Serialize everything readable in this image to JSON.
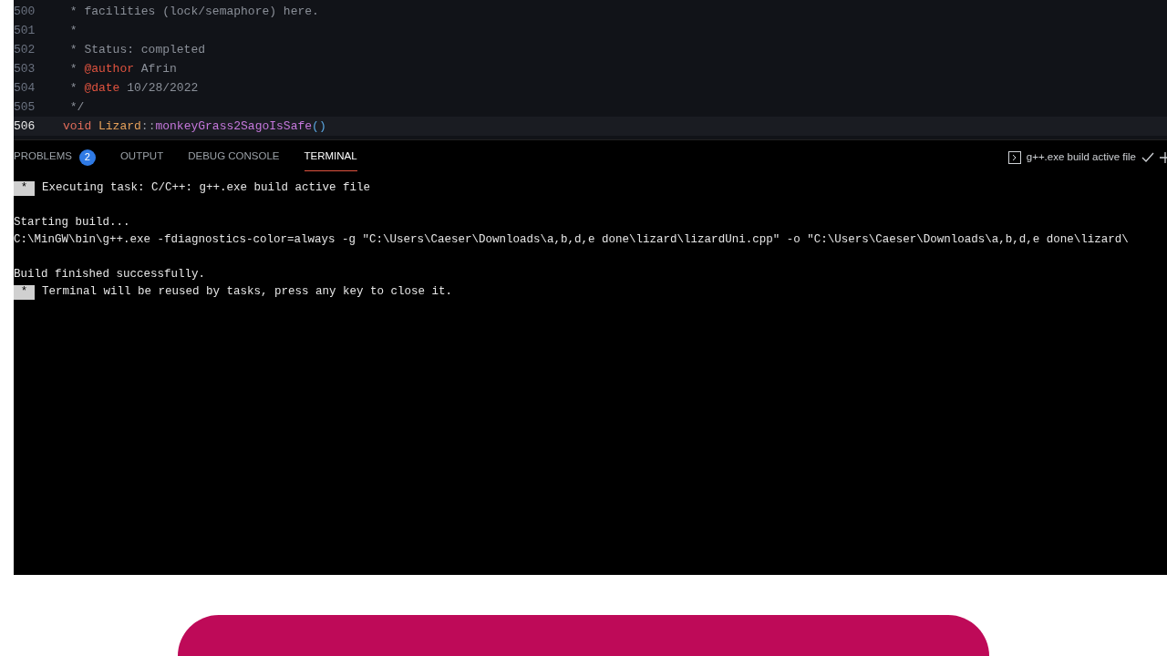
{
  "editor": {
    "lines": [
      {
        "number": "500",
        "current": false,
        "tokens": [
          {
            "text": " * facilities (lock/semaphore) here.",
            "kind": "comment"
          }
        ]
      },
      {
        "number": "501",
        "current": false,
        "tokens": [
          {
            "text": " *",
            "kind": "comment"
          }
        ]
      },
      {
        "number": "502",
        "current": false,
        "tokens": [
          {
            "text": " * Status: completed",
            "kind": "comment"
          }
        ]
      },
      {
        "number": "503",
        "current": false,
        "tokens": [
          {
            "text": " * ",
            "kind": "comment"
          },
          {
            "text": "@author",
            "kind": "tag"
          },
          {
            "text": " Afrin",
            "kind": "comment"
          }
        ]
      },
      {
        "number": "504",
        "current": false,
        "tokens": [
          {
            "text": " * ",
            "kind": "comment"
          },
          {
            "text": "@date",
            "kind": "tag"
          },
          {
            "text": " 10/28/2022",
            "kind": "comment"
          }
        ]
      },
      {
        "number": "505",
        "current": false,
        "tokens": [
          {
            "text": " */",
            "kind": "comment"
          }
        ]
      },
      {
        "number": "506",
        "current": true,
        "tokens": [
          {
            "text": "void ",
            "kind": "keyword"
          },
          {
            "text": "Lizard",
            "kind": "class"
          },
          {
            "text": "::",
            "kind": "punct"
          },
          {
            "text": "monkeyGrass2SagoIsSafe",
            "kind": "function"
          },
          {
            "text": "()",
            "kind": "paren"
          }
        ]
      }
    ]
  },
  "panel": {
    "tabs": [
      {
        "label": "PROBLEMS",
        "selected": false,
        "badge": "2"
      },
      {
        "label": "OUTPUT",
        "selected": false
      },
      {
        "label": "DEBUG CONSOLE",
        "selected": false
      },
      {
        "label": "TERMINAL",
        "selected": true
      }
    ],
    "task_label": "g++.exe build active file"
  },
  "terminal": {
    "lines": [
      {
        "kind": "task",
        "marker": "*",
        "text": "Executing task: C/C++: g++.exe build active file"
      },
      {
        "kind": "blank"
      },
      {
        "kind": "text",
        "text": "Starting build..."
      },
      {
        "kind": "text",
        "text": "C:\\MinGW\\bin\\g++.exe -fdiagnostics-color=always -g \"C:\\Users\\Caeser\\Downloads\\a,b,d,e done\\lizard\\lizardUni.cpp\" -o \"C:\\Users\\Caeser\\Downloads\\a,b,d,e done\\lizard\\"
      },
      {
        "kind": "blank"
      },
      {
        "kind": "text",
        "text": "Build finished successfully."
      },
      {
        "kind": "task",
        "marker": "*",
        "text": "Terminal will be reused by tasks, press any key to close it."
      }
    ]
  }
}
